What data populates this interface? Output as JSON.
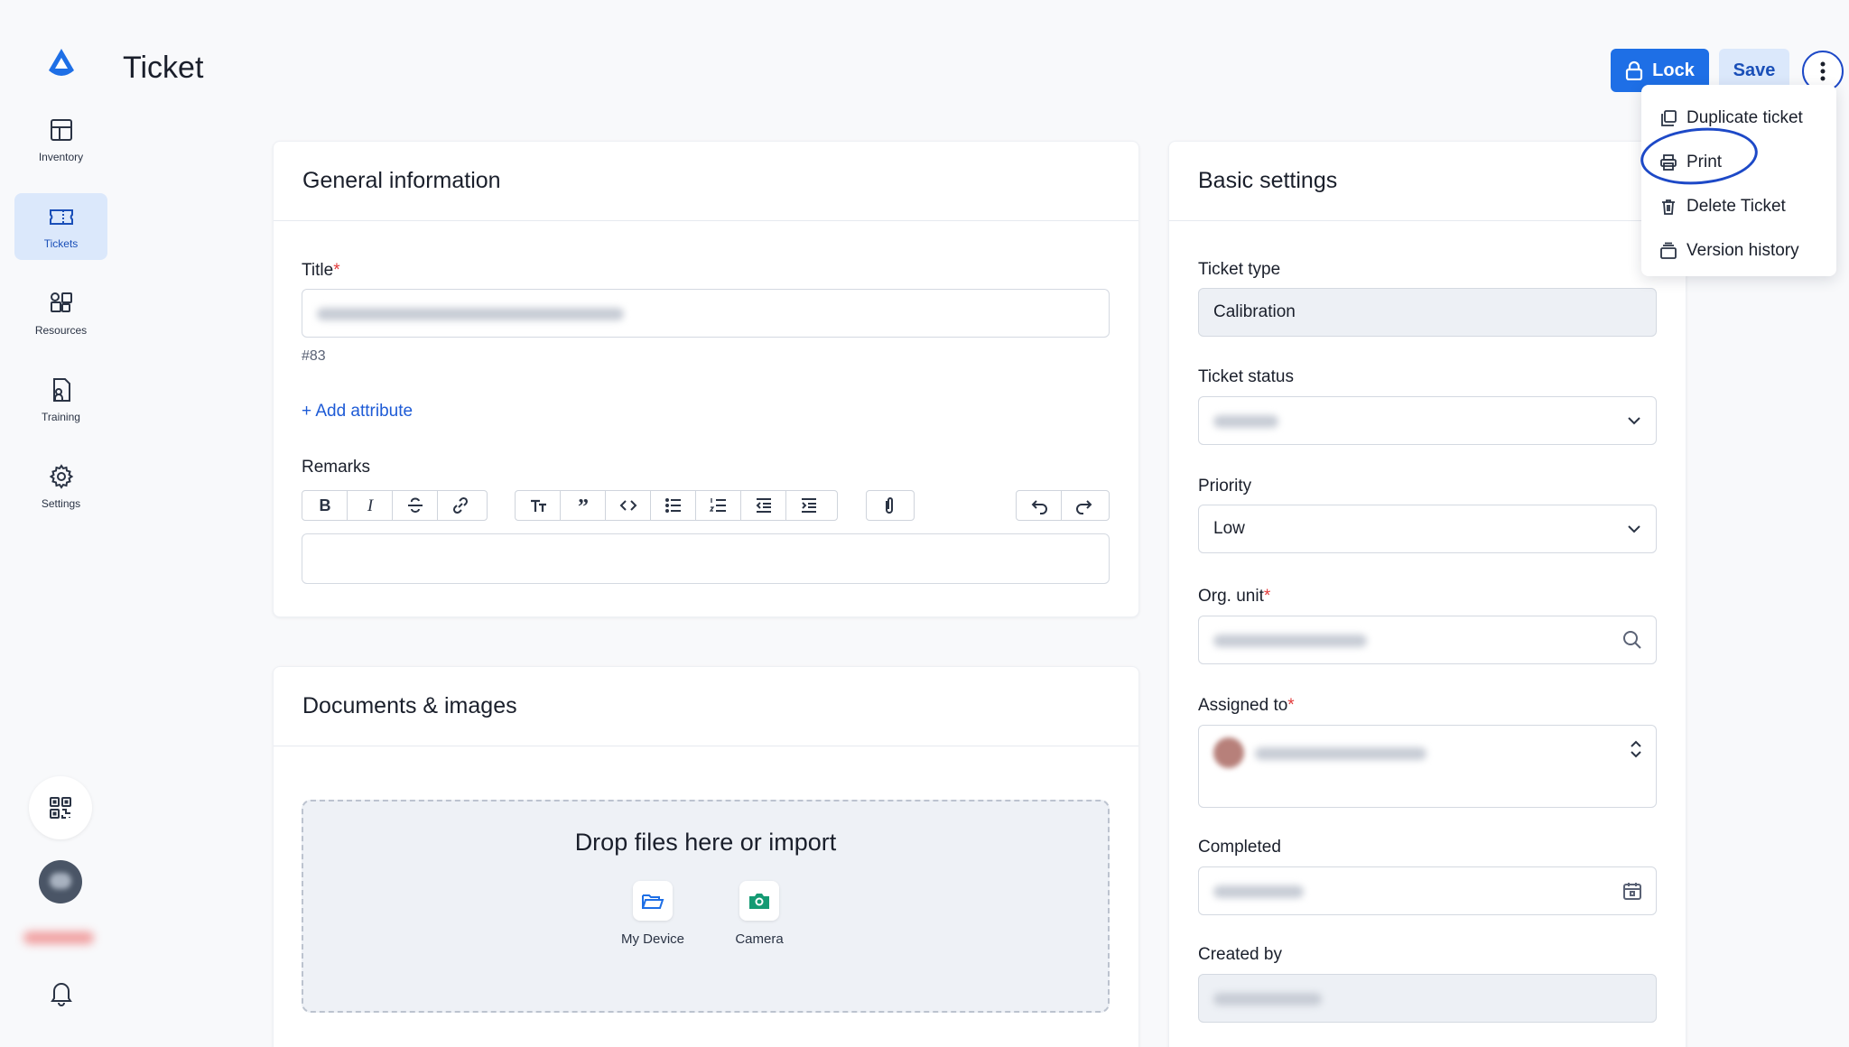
{
  "page": {
    "title": "Ticket"
  },
  "header": {
    "lock_label": "Lock",
    "save_label": "Save"
  },
  "sidebar": {
    "items": [
      {
        "label": "Inventory",
        "icon": "grid-icon"
      },
      {
        "label": "Tickets",
        "icon": "ticket-icon"
      },
      {
        "label": "Resources",
        "icon": "resources-icon"
      },
      {
        "label": "Training",
        "icon": "training-icon"
      },
      {
        "label": "Settings",
        "icon": "gear-icon"
      }
    ]
  },
  "general": {
    "heading": "General information",
    "title_label": "Title",
    "ticket_number": "#83",
    "add_attribute": "+ Add attribute",
    "remarks_label": "Remarks"
  },
  "documents": {
    "heading": "Documents & images",
    "drop_title": "Drop files here or import",
    "my_device": "My Device",
    "camera": "Camera"
  },
  "basic": {
    "heading": "Basic settings",
    "ticket_type_label": "Ticket type",
    "ticket_type_value": "Calibration",
    "ticket_status_label": "Ticket status",
    "priority_label": "Priority",
    "priority_value": "Low",
    "org_unit_label": "Org. unit",
    "assigned_label": "Assigned to",
    "completed_label": "Completed",
    "created_by_label": "Created by"
  },
  "menu": {
    "items": [
      "Duplicate ticket",
      "Print",
      "Delete Ticket",
      "Version history"
    ]
  },
  "colors": {
    "accent": "#1e6fe6",
    "annotation": "#1d49c7",
    "required": "#e23b3b"
  }
}
